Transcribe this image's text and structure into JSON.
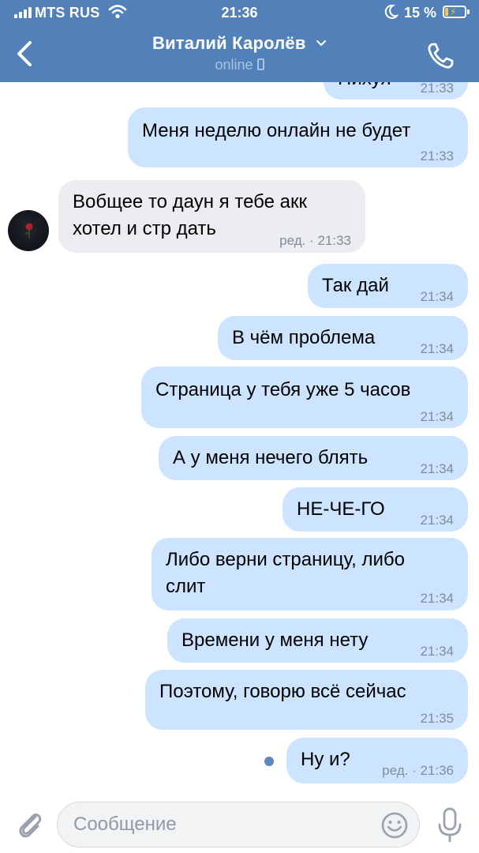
{
  "status_bar": {
    "carrier": "MTS RUS",
    "time": "21:36",
    "battery_percent": "15 %",
    "signal_bars": 4
  },
  "header": {
    "contact_name": "Виталий Каролёв",
    "presence": "online",
    "icons": {
      "back": "chevron-left-icon",
      "name_dropdown": "chevron-down-icon",
      "presence_device": "mobile-phone-icon",
      "call": "phone-icon"
    },
    "background_color": "#5181b8"
  },
  "messages": [
    {
      "direction": "out",
      "text": "Нихуя",
      "time": "21:33",
      "partially_visible": true
    },
    {
      "direction": "out",
      "text": "Меня неделю онлайн не будет",
      "time": "21:33"
    },
    {
      "direction": "in",
      "lines": [
        "Вобщее то даун я тебе акк",
        "хотел и стр дать"
      ],
      "time": "ред. · 21:33"
    },
    {
      "direction": "out",
      "text": "Так дай",
      "time": "21:34"
    },
    {
      "direction": "out",
      "text": "В чём проблема",
      "time": "21:34"
    },
    {
      "direction": "out",
      "text": "Страница у тебя уже 5 часов",
      "time": "21:34"
    },
    {
      "direction": "out",
      "text": "А у меня нечего блять",
      "time": "21:34"
    },
    {
      "direction": "out",
      "text": "НЕ-ЧЕ-ГО",
      "time": "21:34"
    },
    {
      "direction": "out",
      "lines": [
        "Либо верни страницу, либо",
        "слит"
      ],
      "time": "21:34"
    },
    {
      "direction": "out",
      "text": "Времени у меня нету",
      "time": "21:34"
    },
    {
      "direction": "out",
      "text": "Поэтому, говорю всё сейчас",
      "time": "21:35"
    },
    {
      "direction": "out",
      "text": "Ну и?",
      "time": "ред. · 21:36",
      "unread": true
    }
  ],
  "composer": {
    "placeholder": "Сообщение",
    "icons": {
      "attach": "paperclip-icon",
      "emoji": "smiley-icon",
      "voice": "microphone-icon"
    }
  },
  "colors": {
    "outgoing_bubble": "#cce4ff",
    "incoming_bubble": "#ebedf0",
    "timestamp": "#818c99",
    "unread_dot": "#5b88bd"
  }
}
